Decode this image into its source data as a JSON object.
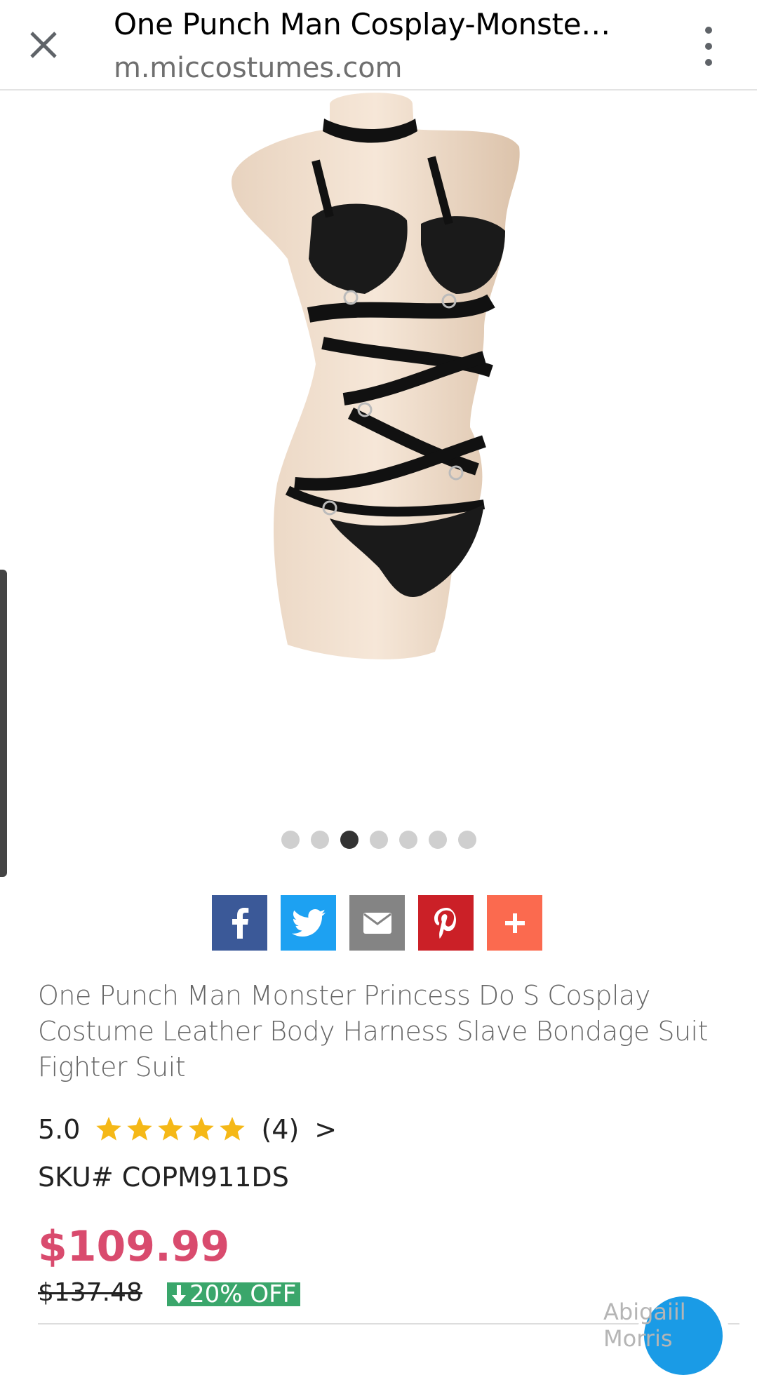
{
  "browser": {
    "title": "One Punch Man Cosplay-Monster…",
    "url": "m.miccostumes.com"
  },
  "carousel": {
    "total": 7,
    "active_index": 2
  },
  "share": {
    "buttons": [
      "facebook",
      "twitter",
      "email",
      "pinterest",
      "more"
    ],
    "colors": {
      "facebook": "#3b5998",
      "twitter": "#1da1f2",
      "email": "#848484",
      "pinterest": "#cb2027",
      "more": "#fb6a4f"
    }
  },
  "product": {
    "title": "One Punch Man Monster Princess Do S Cosplay Costume Leather Body Harness Slave Bondage Suit Fighter Suit",
    "rating": "5.0",
    "stars": 5,
    "review_count": "(4)",
    "reviews_arrow": ">",
    "sku": "SKU# COPM911DS",
    "price": "$109.99",
    "old_price": "$137.48",
    "discount": "20% OFF"
  },
  "watermark": "Abigaiil Morris",
  "colors": {
    "price": "#d94b6e",
    "discount_bg": "#3aa66b",
    "star": "#f5b817",
    "fab": "#1a9be6"
  }
}
